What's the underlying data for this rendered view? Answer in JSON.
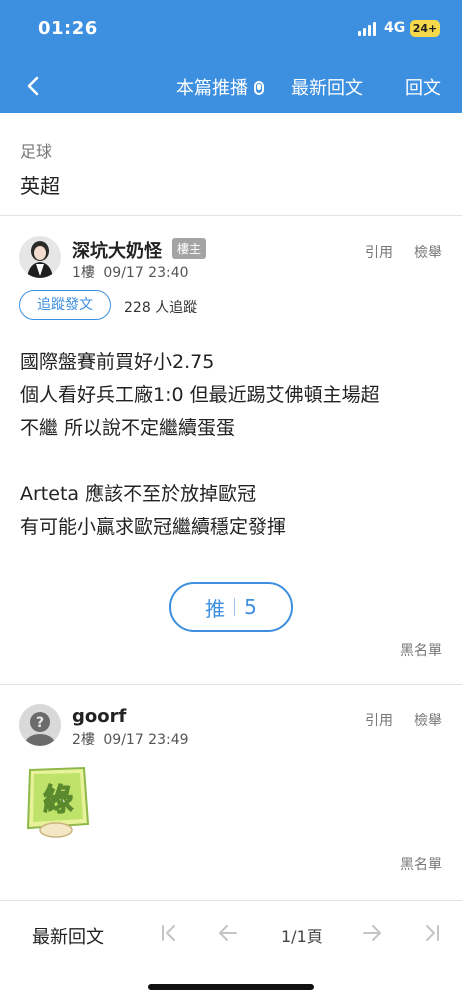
{
  "status": {
    "time": "01:26",
    "network": "4G",
    "battery": "24+"
  },
  "nav": {
    "push_label": "本篇推播",
    "latest_label": "最新回文",
    "reply_label": "回文"
  },
  "thread": {
    "category": "足球",
    "board": "英超"
  },
  "posts": [
    {
      "author": "深坑大奶怪",
      "badge": "樓主",
      "floor": "1樓",
      "time": "09/17 23:40",
      "quote_label": "引用",
      "report_label": "檢舉",
      "follow_label": "追蹤發文",
      "follow_count": "228 人追蹤",
      "lines": [
        "國際盤賽前買好小2.75",
        "個人看好兵工廠1:0 但最近踢艾佛頓主場超",
        "不繼 所以說不定繼續蛋蛋",
        "",
        "Arteta 應該不至於放掉歐冠",
        "有可能小贏求歐冠繼續穩定發揮"
      ],
      "push_label": "推",
      "push_count": "5",
      "blacklist_label": "黑名單"
    },
    {
      "author": "goorf",
      "floor": "2樓",
      "time": "09/17 23:49",
      "quote_label": "引用",
      "report_label": "檢舉",
      "sticker_text": "綠",
      "blacklist_label": "黑名單"
    }
  ],
  "bottom": {
    "latest_label": "最新回文",
    "page": "1/1頁"
  },
  "colors": {
    "primary": "#3d8fe0",
    "badge": "#a4a4a4",
    "battery": "#f6d94a"
  }
}
